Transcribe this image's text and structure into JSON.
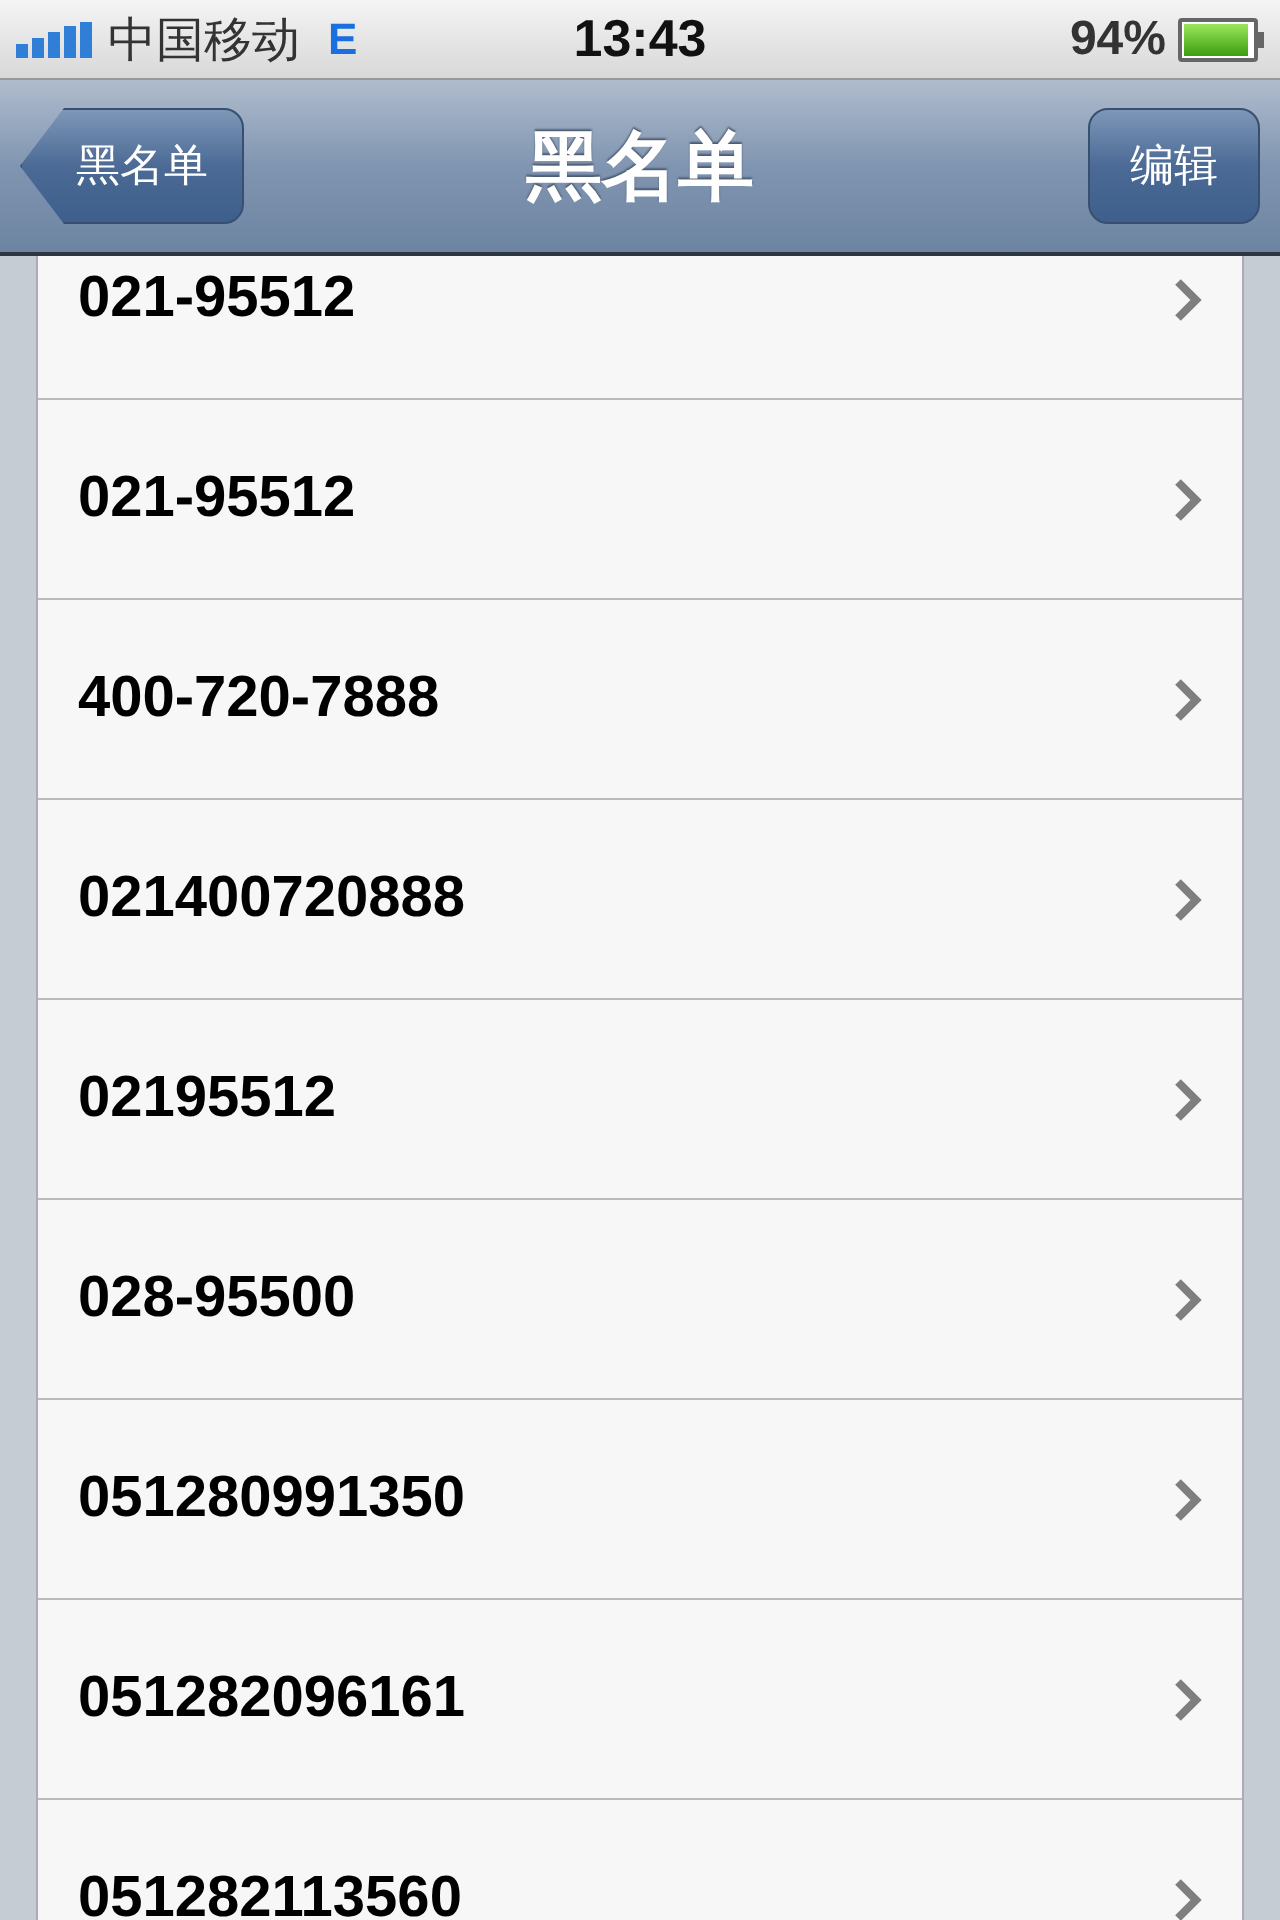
{
  "status_bar": {
    "carrier": "中国移动",
    "network": "E",
    "time": "13:43",
    "battery": "94%"
  },
  "nav_bar": {
    "back": "黑名单",
    "title": "黑名单",
    "action": "编辑"
  },
  "list": [
    {
      "number": "021-95512"
    },
    {
      "number": "021-95512"
    },
    {
      "number": "400-720-7888"
    },
    {
      "number": "021400720888"
    },
    {
      "number": "02195512"
    },
    {
      "number": "028-95500"
    },
    {
      "number": "051280991350"
    },
    {
      "number": "051282096161"
    },
    {
      "number": "051282113560"
    }
  ]
}
